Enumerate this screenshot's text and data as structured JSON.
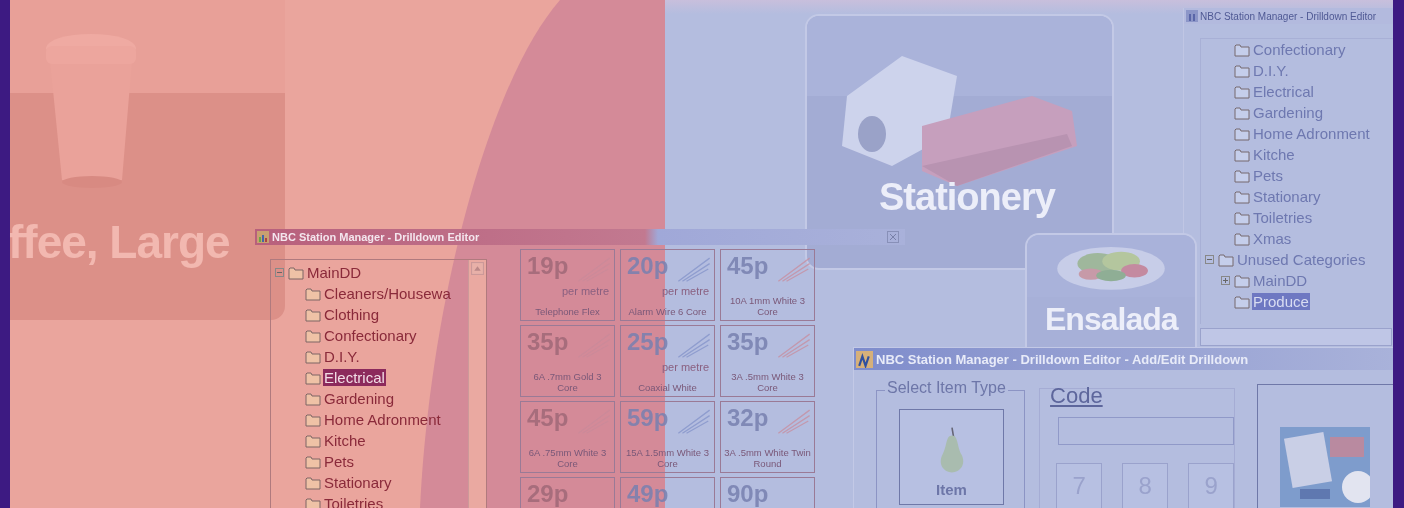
{
  "promo_cards": [
    {
      "kind": "cup",
      "label": "ffee, Large"
    },
    {
      "kind": "stationery",
      "label": "Stationery"
    },
    {
      "kind": "salad",
      "label": "Ensalada"
    }
  ],
  "drilldown_editor": {
    "title": "NBC Station Manager - Drilldown Editor",
    "tree": [
      {
        "label": "MainDD",
        "expanded": true,
        "selected": false,
        "children": [
          {
            "label": "Cleaners/Housewa",
            "selected": false
          },
          {
            "label": "Clothing",
            "selected": false
          },
          {
            "label": "Confectionary",
            "selected": false
          },
          {
            "label": "D.I.Y.",
            "selected": false
          },
          {
            "label": "Electrical",
            "selected": true
          },
          {
            "label": "Gardening",
            "selected": false
          },
          {
            "label": "Home Adronment",
            "selected": false
          },
          {
            "label": "Kitche",
            "selected": false
          },
          {
            "label": "Pets",
            "selected": false
          },
          {
            "label": "Stationary",
            "selected": false
          },
          {
            "label": "Toiletries",
            "selected": false
          }
        ]
      }
    ],
    "tiles": [
      {
        "price": "19p",
        "unit": "per metre",
        "name": "Telephone Flex"
      },
      {
        "price": "20p",
        "unit": "per metre",
        "name": "Alarm Wire 6 Core"
      },
      {
        "price": "45p",
        "name": "10A 1mm White 3 Core"
      },
      {
        "price": "35p",
        "name": "6A .7mm Gold 3 Core"
      },
      {
        "price": "25p",
        "unit": "per metre",
        "name": "Coaxial White"
      },
      {
        "price": "35p",
        "name": "3A .5mm White 3 Core"
      },
      {
        "price": "45p",
        "name": "6A .75mm White 3 Core"
      },
      {
        "price": "59p",
        "name": "15A 1.5mm White 3 Core"
      },
      {
        "price": "32p",
        "name": "3A .5mm White Twin Round"
      },
      {
        "price": "29p"
      },
      {
        "price": "49p"
      },
      {
        "price": "90p"
      }
    ]
  },
  "drilldown_editor_2": {
    "title": "NBC Station Manager - Drilldown Editor",
    "tree": [
      {
        "children": [
          {
            "label": "Confectionary",
            "selected": false
          },
          {
            "label": "D.I.Y.",
            "selected": false
          },
          {
            "label": "Electrical",
            "selected": false
          },
          {
            "label": "Gardening",
            "selected": false
          },
          {
            "label": "Home Adronment",
            "selected": false
          },
          {
            "label": "Kitche",
            "selected": false
          },
          {
            "label": "Pets",
            "selected": false
          },
          {
            "label": "Stationary",
            "selected": false
          },
          {
            "label": "Toiletries",
            "selected": false
          },
          {
            "label": "Xmas",
            "selected": false
          }
        ]
      },
      {
        "label": "Unused Categories",
        "expanded": true,
        "selected": false,
        "children": [
          {
            "label": "MainDD",
            "expanded": false,
            "selected": false
          },
          {
            "label": "Produce",
            "selected": true
          }
        ]
      }
    ]
  },
  "add_edit_dialog": {
    "title": "NBC Station Manager - Drilldown Editor - Add/Edit Drilldown",
    "item_type_group": "Select Item Type",
    "item_button": "Item",
    "code_label": "Code",
    "keypad": [
      "7",
      "8",
      "9"
    ]
  }
}
